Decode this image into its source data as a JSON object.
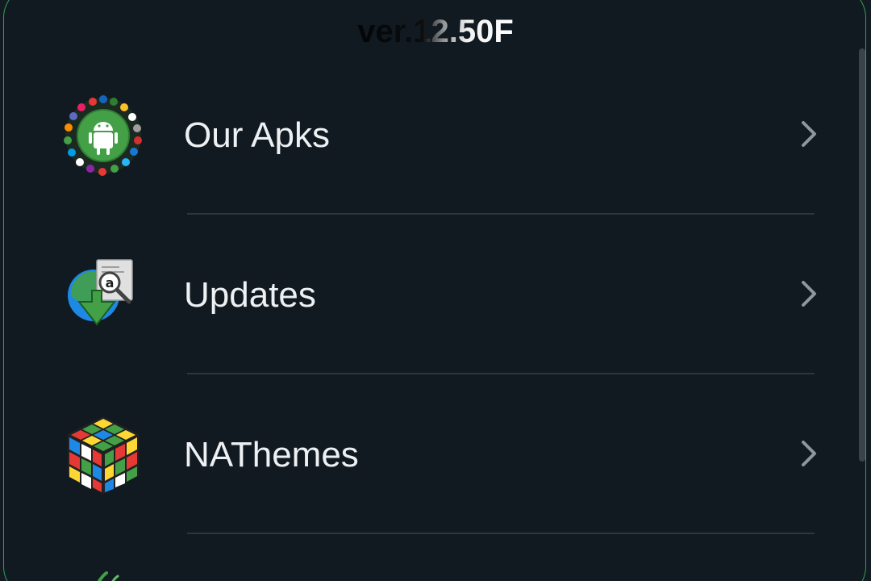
{
  "header": {
    "version": "ver.12.50F"
  },
  "menu": {
    "items": [
      {
        "label": "Our Apks",
        "icon": "android-apps-icon"
      },
      {
        "label": "Updates",
        "icon": "download-update-icon"
      },
      {
        "label": "NAThemes",
        "icon": "rubik-cube-icon"
      },
      {
        "label": "",
        "icon": "partial-next-icon"
      }
    ]
  },
  "colors": {
    "background": "#111a21",
    "border": "#3c9a55",
    "text": "#eef1f3",
    "divider": "#2b363d",
    "chevron": "#8e979d"
  }
}
